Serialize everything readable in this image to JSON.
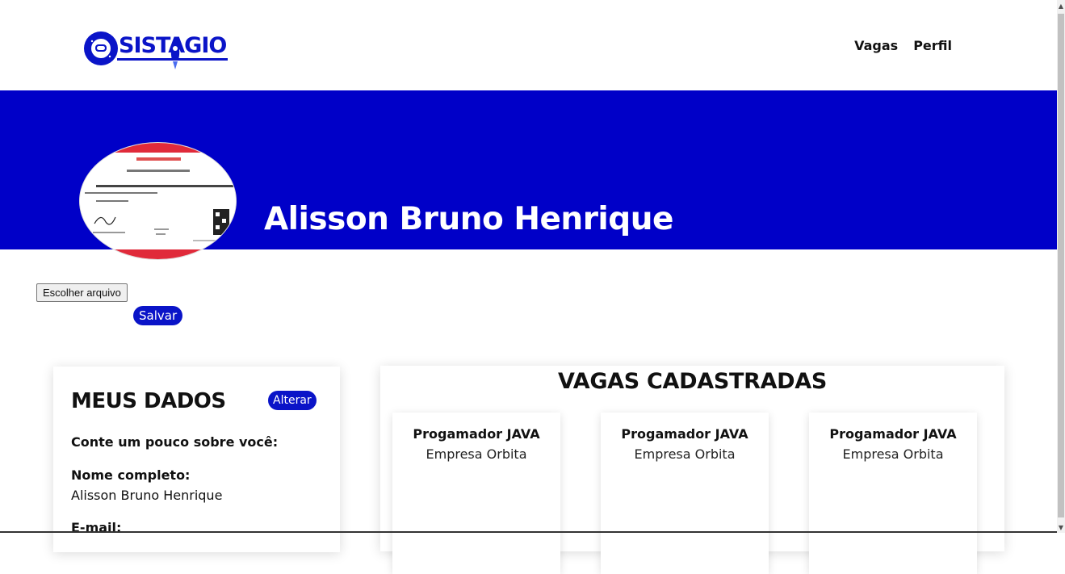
{
  "brand": {
    "name": "SISTAGIO",
    "accent": "#0a14c8"
  },
  "nav": {
    "vagas": "Vagas",
    "perfil": "Perfil"
  },
  "profile": {
    "name": "Alisson Bruno Henrique",
    "photo_alt": "certificate-photo",
    "banner_color": "#0000c8"
  },
  "upload": {
    "file_button": "Escolher arquivo",
    "save_button": "Salvar"
  },
  "my_data": {
    "title": "MEUS DADOS",
    "alter_button": "Alterar",
    "about_label": "Conte um pouco sobre você:",
    "name_label": "Nome completo:",
    "name_value": "Alisson Bruno Henrique",
    "email_label": "E-mail:"
  },
  "jobs": {
    "title": "VAGAS CADASTRADAS",
    "items": [
      {
        "title": "Progamador JAVA",
        "company": "Empresa Orbita"
      },
      {
        "title": "Progamador JAVA",
        "company": "Empresa Orbita"
      },
      {
        "title": "Progamador JAVA",
        "company": "Empresa Orbita"
      }
    ]
  }
}
